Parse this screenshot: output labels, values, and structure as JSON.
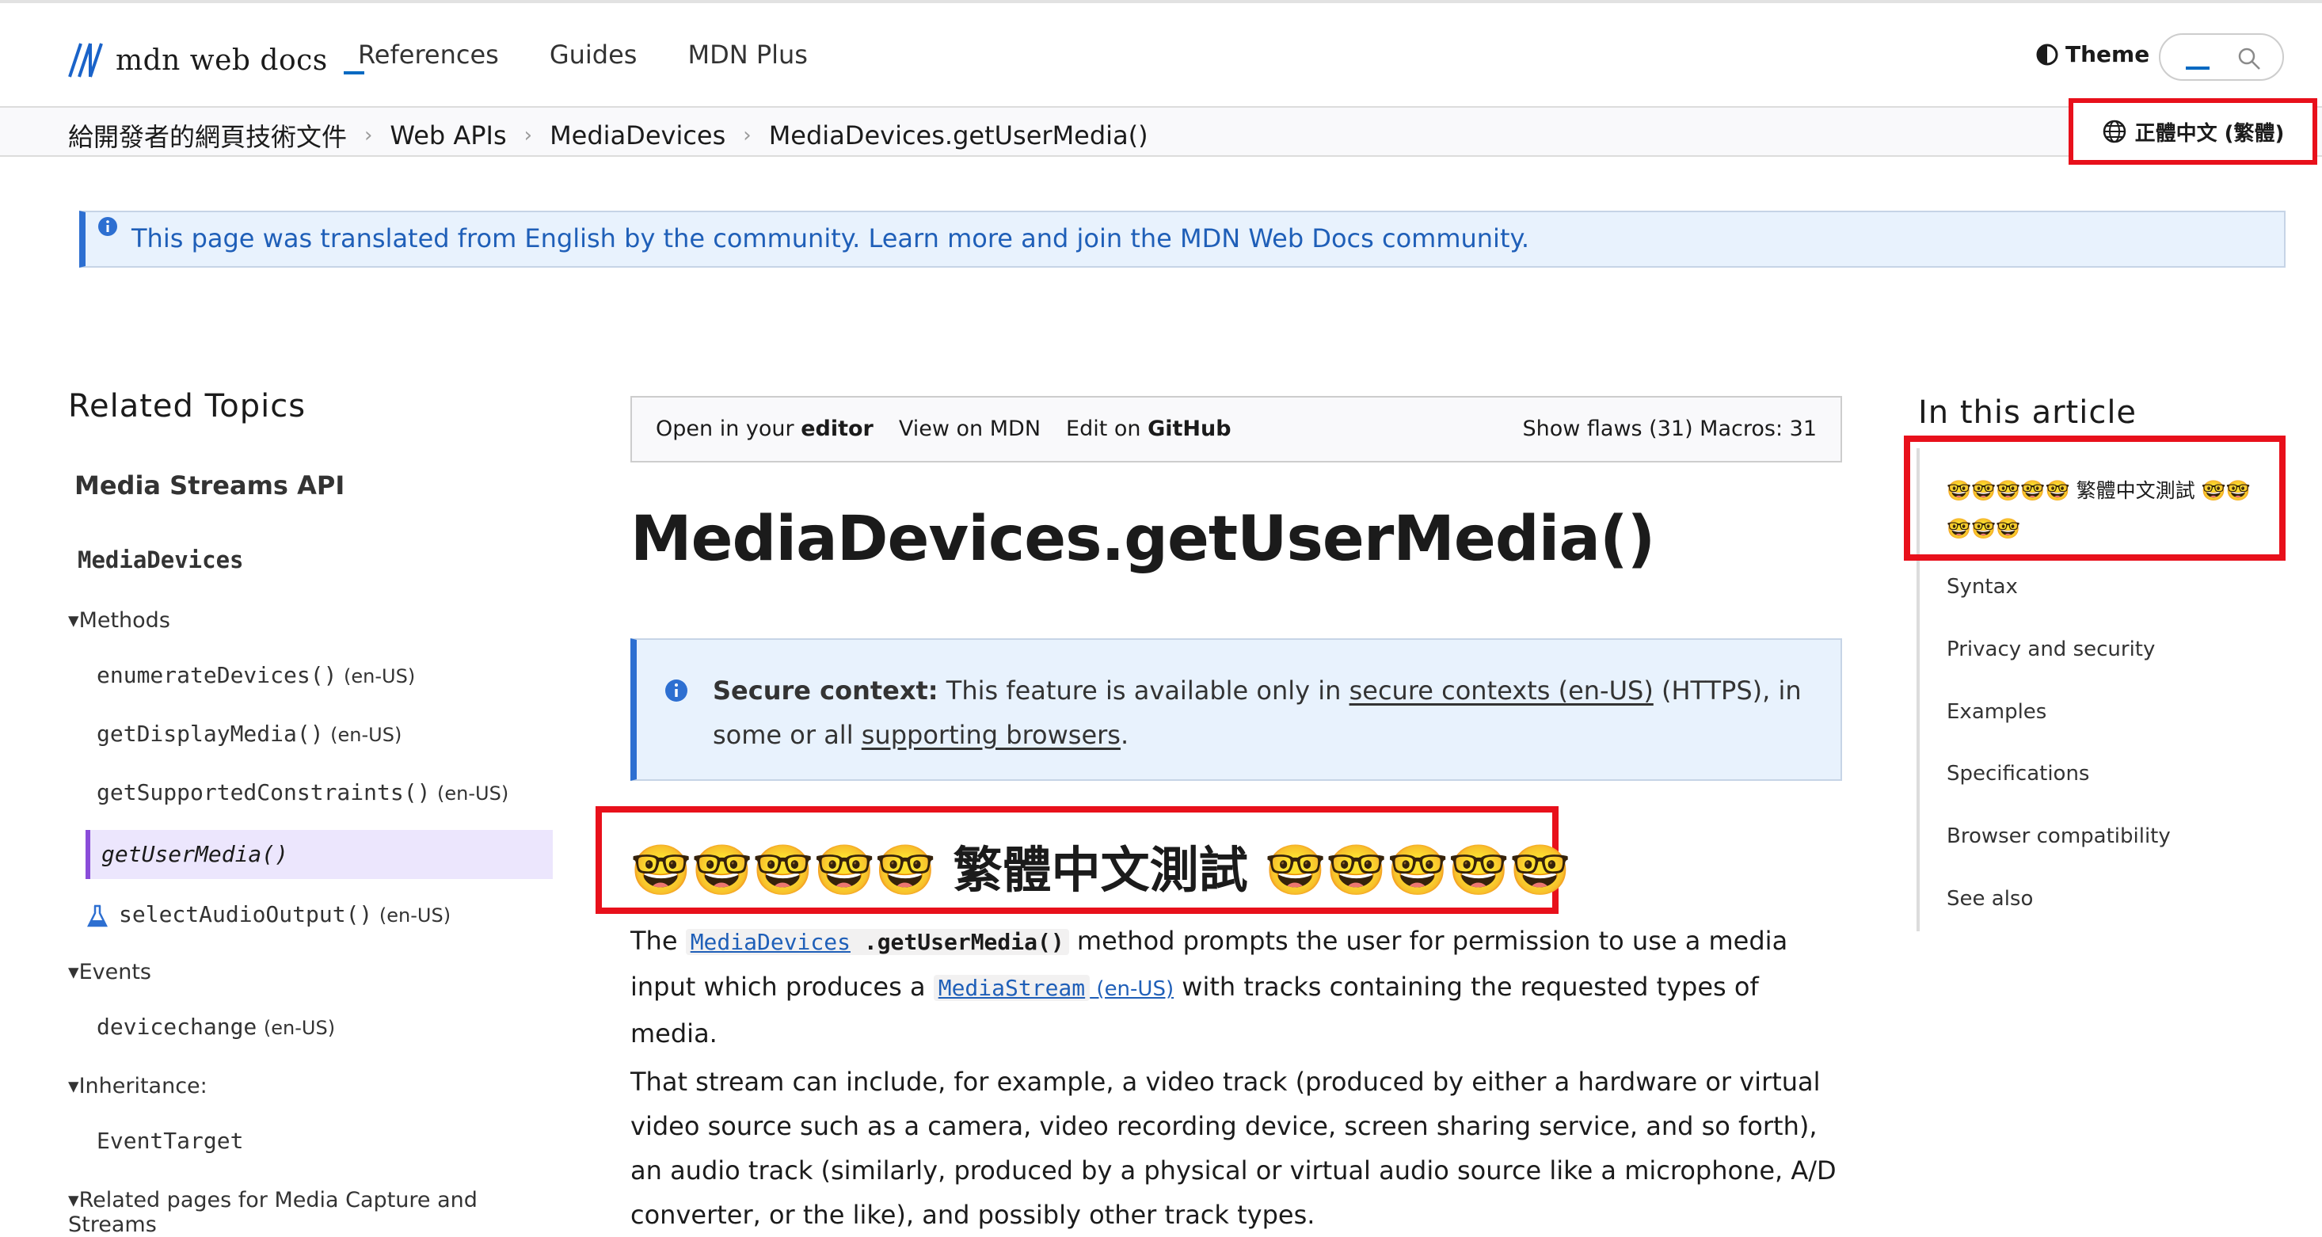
{
  "header": {
    "logo_text": "mdn web docs",
    "nav": [
      "References",
      "Guides",
      "MDN Plus"
    ],
    "theme_label": "Theme"
  },
  "breadcrumb": [
    "給開發者的網頁技術文件",
    "Web APIs",
    "MediaDevices",
    "MediaDevices.getUserMedia()"
  ],
  "language_button": "正體中文 (繁體)",
  "notice": {
    "prefix": "This page was translated from English by the community. ",
    "link": "Learn more and join the MDN Web Docs community."
  },
  "sidebar": {
    "title": "Related Topics",
    "section": "Media Streams API",
    "interface": "MediaDevices",
    "methods_label": "Methods",
    "methods": [
      {
        "name": "enumerateDevices()",
        "locale": "(en-US)"
      },
      {
        "name": "getDisplayMedia()",
        "locale": "(en-US)"
      },
      {
        "name": "getSupportedConstraints()",
        "locale": "(en-US)"
      },
      {
        "name": "getUserMedia()",
        "locale": ""
      },
      {
        "name": "selectAudioOutput()",
        "locale": "(en-US)"
      }
    ],
    "events_label": "Events",
    "events": [
      {
        "name": "devicechange",
        "locale": "(en-US)"
      }
    ],
    "inheritance_label": "Inheritance:",
    "inheritance": [
      "EventTarget"
    ],
    "related_label": "Related pages for Media Capture and Streams"
  },
  "toolbar": {
    "open_prefix": "Open in your ",
    "open_bold": "editor",
    "view": "View on MDN",
    "edit_prefix": "Edit on ",
    "edit_bold": "GitHub",
    "flaws": "Show flaws (31) Macros: 31"
  },
  "article": {
    "title": "MediaDevices.getUserMedia()",
    "secure_label": "Secure context:",
    "secure_text_1": " This feature is available only in ",
    "secure_link_1": "secure contexts (en-US)",
    "secure_text_2": " (HTTPS), in some or all ",
    "secure_link_2": "supporting browsers",
    "secure_text_3": ".",
    "heading": "🤓🤓🤓🤓🤓 繁體中文測試 🤓🤓🤓🤓🤓",
    "p1_the": "The ",
    "p1_link": "MediaDevices",
    "p1_method": ".getUserMedia()",
    "p1_text_1": " method prompts the user for permission to use a media input which produces a ",
    "p1_link2": "MediaStream",
    "p1_locale": " (en-US)",
    "p1_text_2": " with tracks containing the requested types of media.",
    "p2": "That stream can include, for example, a video track (produced by either a hardware or virtual video source such as a camera, video recording device, screen sharing service, and so forth), an audio track (similarly, produced by a physical or virtual audio source like a microphone, A/D converter, or the like), and possibly other track types."
  },
  "toc": {
    "title": "In this article",
    "items": [
      "🤓🤓🤓🤓🤓 繁體中文測試 🤓🤓🤓🤓🤓",
      "Syntax",
      "Privacy and security",
      "Examples",
      "Specifications",
      "Browser compatibility",
      "See also"
    ]
  },
  "colors": {
    "accent": "#0069c2",
    "highlight": "#e8101b",
    "active_bg": "#ece6fd",
    "active_border": "#8a4cd9",
    "notice_bg": "#e8f2fd"
  }
}
